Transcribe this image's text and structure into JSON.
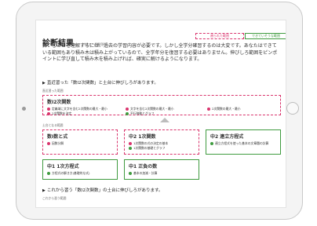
{
  "header": {
    "title": "診断結果",
    "subtitle": "（中1で一問解答）",
    "legend_learned": "遡られた範囲",
    "legend_can": "できていそうな範囲"
  },
  "intro": "算いしことを理解するには、過去の学習内容が必要です。しかし全学分確習するのは大変です。あなたはできている範囲もあり積み木は積み上がっているので、全学年分を復習する必要はありません。伸びしろ範囲をピンポイントに学び直して積み木を積み上げれば、確実に解けるようになります。",
  "section1": {
    "heading": "直近習った「数Ⅰ2次関数」と土台に伸びしろがあります。",
    "label": "直近習った範囲",
    "card": {
      "title": "数Ⅰ2次関数",
      "items": [
        {
          "text": "定義域に文字を含む2次関数の最大・最小",
          "color": "pink"
        },
        {
          "text": "文字を含む2次関数の最大・最小",
          "color": "pink"
        },
        {
          "text": "2次関数の最大・最小",
          "color": "pink"
        },
        {
          "text": "2次関数を決定",
          "color": "pink"
        },
        {
          "text": "平行移動とグラフ",
          "color": "green"
        }
      ]
    }
  },
  "section2": {
    "label": "土台となる範囲",
    "cards": [
      {
        "title": "数Ⅰ数と式",
        "style": "learned",
        "items": [
          {
            "text": "因数分解",
            "color": "pink"
          }
        ]
      },
      {
        "title": "中2 1次関数",
        "style": "learned",
        "items": [
          {
            "text": "1次関数の式の決定の基本",
            "color": "pink"
          },
          {
            "text": "1次関数の基礎とグラフ",
            "color": "green"
          }
        ]
      },
      {
        "title": "中2 連立方程式",
        "style": "can",
        "items": [
          {
            "text": "連立方程式を使った基本の文章題の計算",
            "color": "green"
          }
        ]
      },
      {
        "title": "中1 1次方程式",
        "style": "can",
        "items": [
          {
            "text": "方程式の解き方(基礎的な式)",
            "color": "green"
          }
        ]
      },
      {
        "title": "中1 正負の数",
        "style": "can",
        "items": [
          {
            "text": "基本の加減・計算",
            "color": "green"
          }
        ]
      }
    ]
  },
  "section3": {
    "heading": "これから習う「数Ⅰ2次関数」の土台に伸びしろがあります。",
    "label": "これから習う範囲"
  },
  "colors": {
    "learned": "#d9346d",
    "can": "#3f9b3f"
  }
}
